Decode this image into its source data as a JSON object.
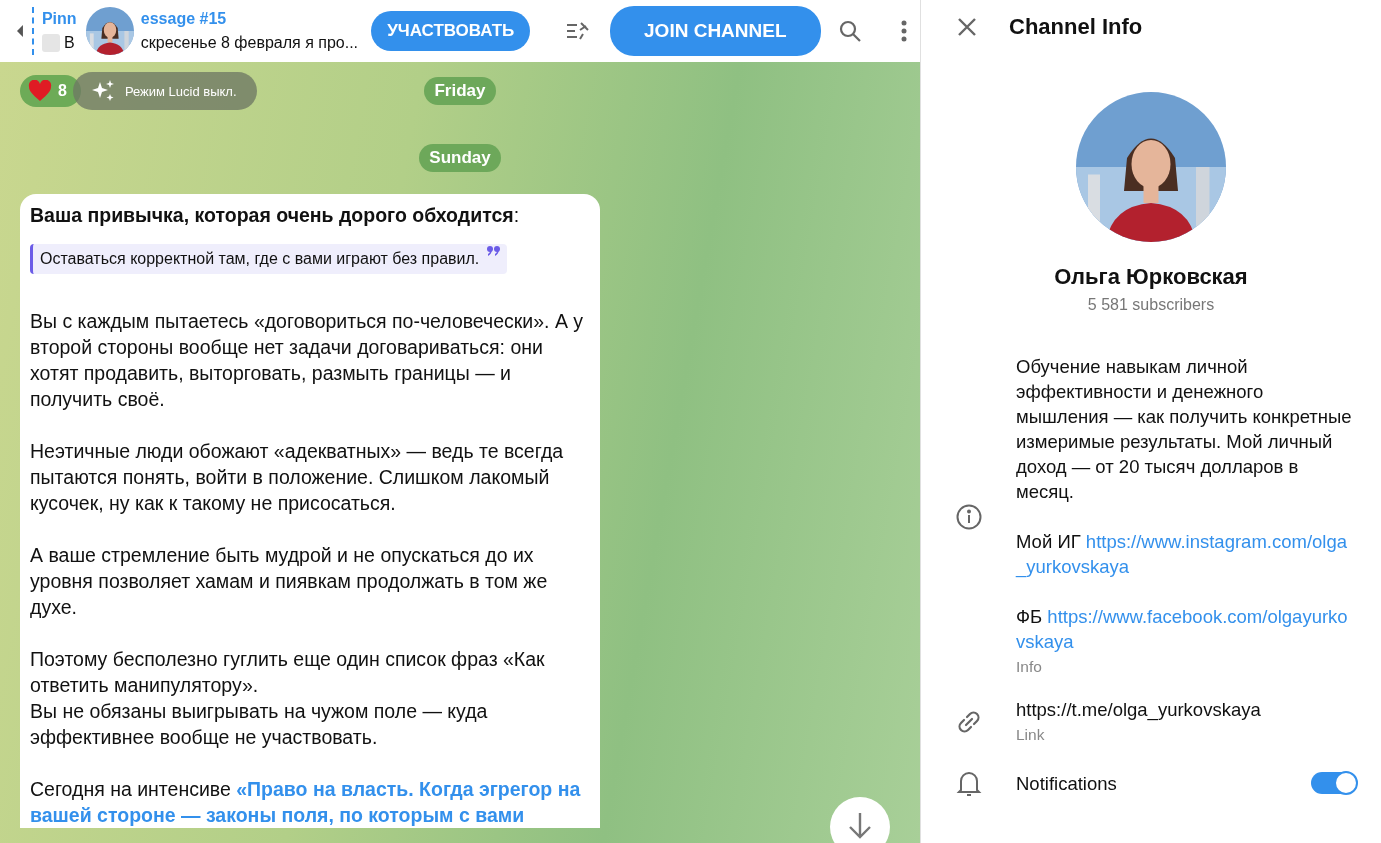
{
  "header": {
    "pinned_title_left": "Pinn",
    "pinned_title_right": "essage #15",
    "pinned_preview_left": "В",
    "pinned_preview_right": "скресенье 8 февраля я про...",
    "participate_button": "УЧАСТВОВАТЬ",
    "join_button": "JOIN CHANNEL"
  },
  "reaction": {
    "count": "8"
  },
  "lucid_badge": "Режим Lucid выкл.",
  "date_pills": [
    "Friday",
    "Sunday"
  ],
  "message": {
    "title": "**Ваша привычка, которая очень дорого обходится**:",
    "quote": "Оставаться корректной там, где с вами играют без правил.",
    "paragraphs": [
      "Вы с каждым пытаетесь «договориться по-человечески». А у второй стороны вообще нет задачи договариваться: они хотят продавить, выторговать, размыть границы — и получить своё.",
      "Неэтичные люди обожают «адекватных» — ведь те всегда пытаются понять, войти в положение. Слишком лакомый кусочек, ну как к такому не присосаться.",
      "А ваше стремление быть мудрой и не опускаться до их уровня позволяет хамам и пиявкам продолжать в том же духе.",
      "Поэтому бесполезно гуглить еще один список фраз «Как ответить манипулятору».\nВы не обязаны выигрывать на чужом поле — куда эффективнее вообще не участвовать."
    ],
    "last_text": "Сегодня на интенсиве ",
    "last_link": "«Право на власть. Когда эгрегор на вашей стороне — законы поля, по которым с вами"
  },
  "channel_info": {
    "title": "Channel Info",
    "name": "Ольга Юрковская",
    "subscribers": "5 581 subscribers",
    "description": "Обучение навыкам личной эффективности и денежного мышления — как получить конкретные измеримые результаты. Мой личный доход — от 20 тысяч долларов в месяц.",
    "instagram_label": "Мой ИГ ",
    "instagram_link": "https://www.instagram.com/olga_yurkovskaya",
    "facebook_label": "ФБ ",
    "facebook_link": "https://www.facebook.com/olgayurkovskaya",
    "info_caption": "Info",
    "link": "https://t.me/olga_yurkovskaya",
    "link_caption": "Link"
  },
  "notifications": {
    "label": "Notifications",
    "on": true
  }
}
